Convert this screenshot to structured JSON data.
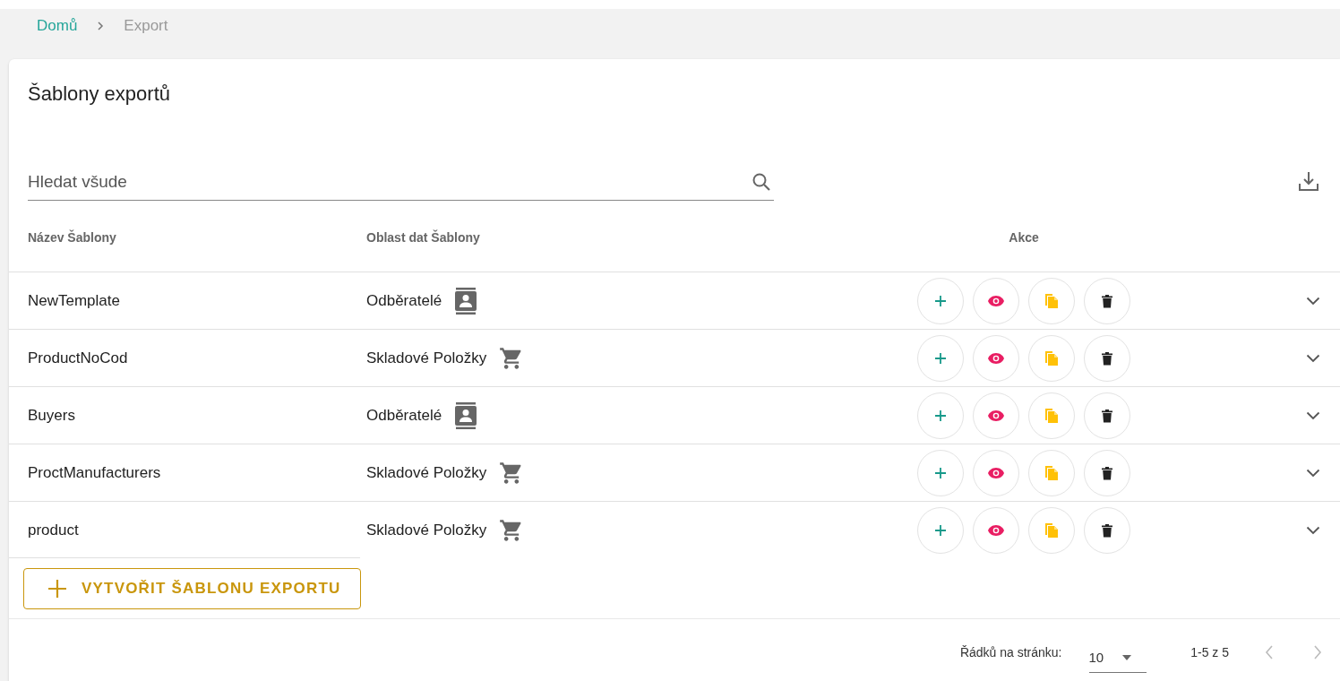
{
  "breadcrumb": [
    {
      "label": "Domů",
      "kind": "link"
    },
    {
      "label": "Export",
      "kind": "current"
    }
  ],
  "title": "Šablony exportů",
  "search": {
    "placeholder": "Hledat všude"
  },
  "table": {
    "columns": [
      "Název Šablony",
      "Oblast dat Šablony",
      "Akce"
    ],
    "rows": [
      {
        "name": "NewTemplate",
        "area": "Odběratelé",
        "kind": "contacts"
      },
      {
        "name": "ProductNoCod",
        "area": "Skladové Položky",
        "kind": "cart"
      },
      {
        "name": "Buyers",
        "area": "Odběratelé",
        "kind": "contacts"
      },
      {
        "name": "ProctManufacturers",
        "area": "Skladové Položky",
        "kind": "cart"
      },
      {
        "name": "product",
        "area": "Skladové Položky",
        "kind": "cart"
      }
    ]
  },
  "create_button": "VYTVOŘIT ŠABLONU EXPORTU",
  "pagination": {
    "rows_label": "Řádků na stránku:",
    "rows_value": "10",
    "range": "1-5 z 5"
  }
}
